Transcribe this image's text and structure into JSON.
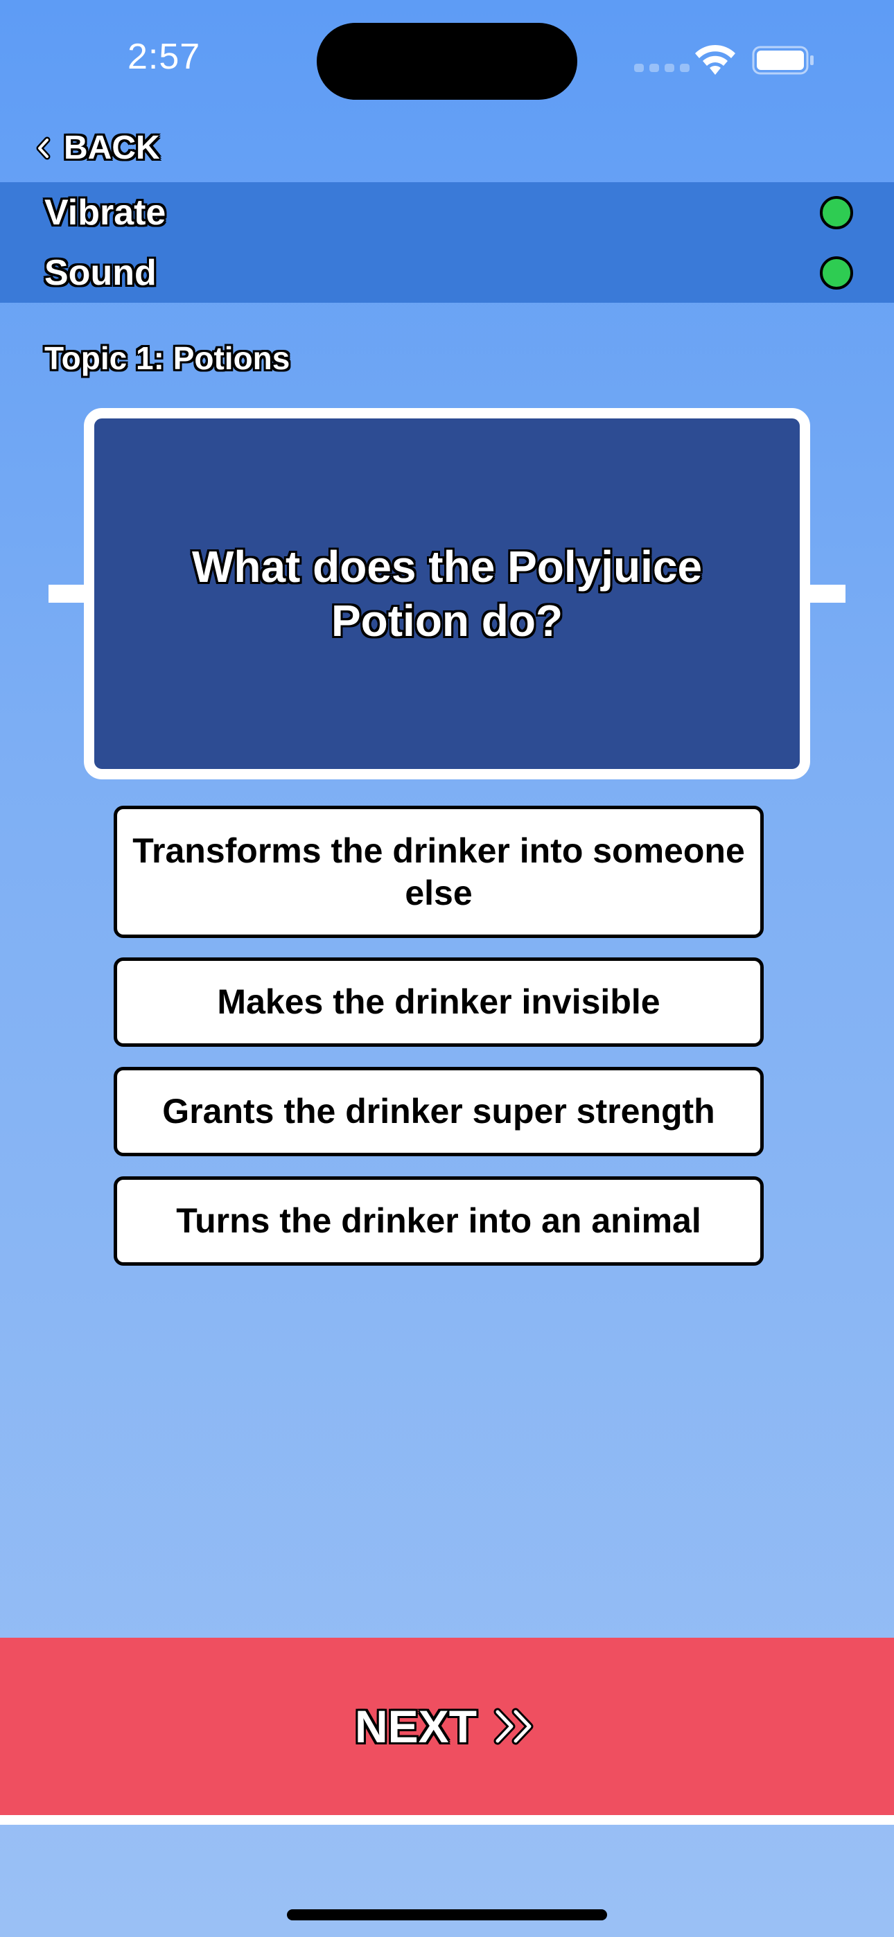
{
  "status_bar": {
    "time": "2:57"
  },
  "nav": {
    "back_label": "BACK",
    "back_icon": "chevron-left-icon"
  },
  "settings": {
    "items": [
      {
        "label": "Vibrate",
        "enabled": true,
        "indicator_color": "#2ecc52"
      },
      {
        "label": "Sound",
        "enabled": true,
        "indicator_color": "#2ecc52"
      }
    ]
  },
  "topic": {
    "label": "Topic 1: Potions"
  },
  "question": {
    "text": "What does the Polyjuice Potion do?"
  },
  "answers": [
    {
      "label": "Transforms the drinker into someone else"
    },
    {
      "label": "Makes the drinker invisible"
    },
    {
      "label": "Grants the drinker super strength"
    },
    {
      "label": "Turns the drinker into an animal"
    }
  ],
  "footer": {
    "next_label": "NEXT",
    "next_icon": "double-chevron-right-icon"
  },
  "colors": {
    "background_top": "#5e9cf5",
    "background_bottom": "#9ac0f5",
    "settings_strip": "#3a7ad8",
    "question_card": "#2d4c93",
    "next_button": "#ef4f60",
    "toggle_on": "#2ecc52"
  }
}
